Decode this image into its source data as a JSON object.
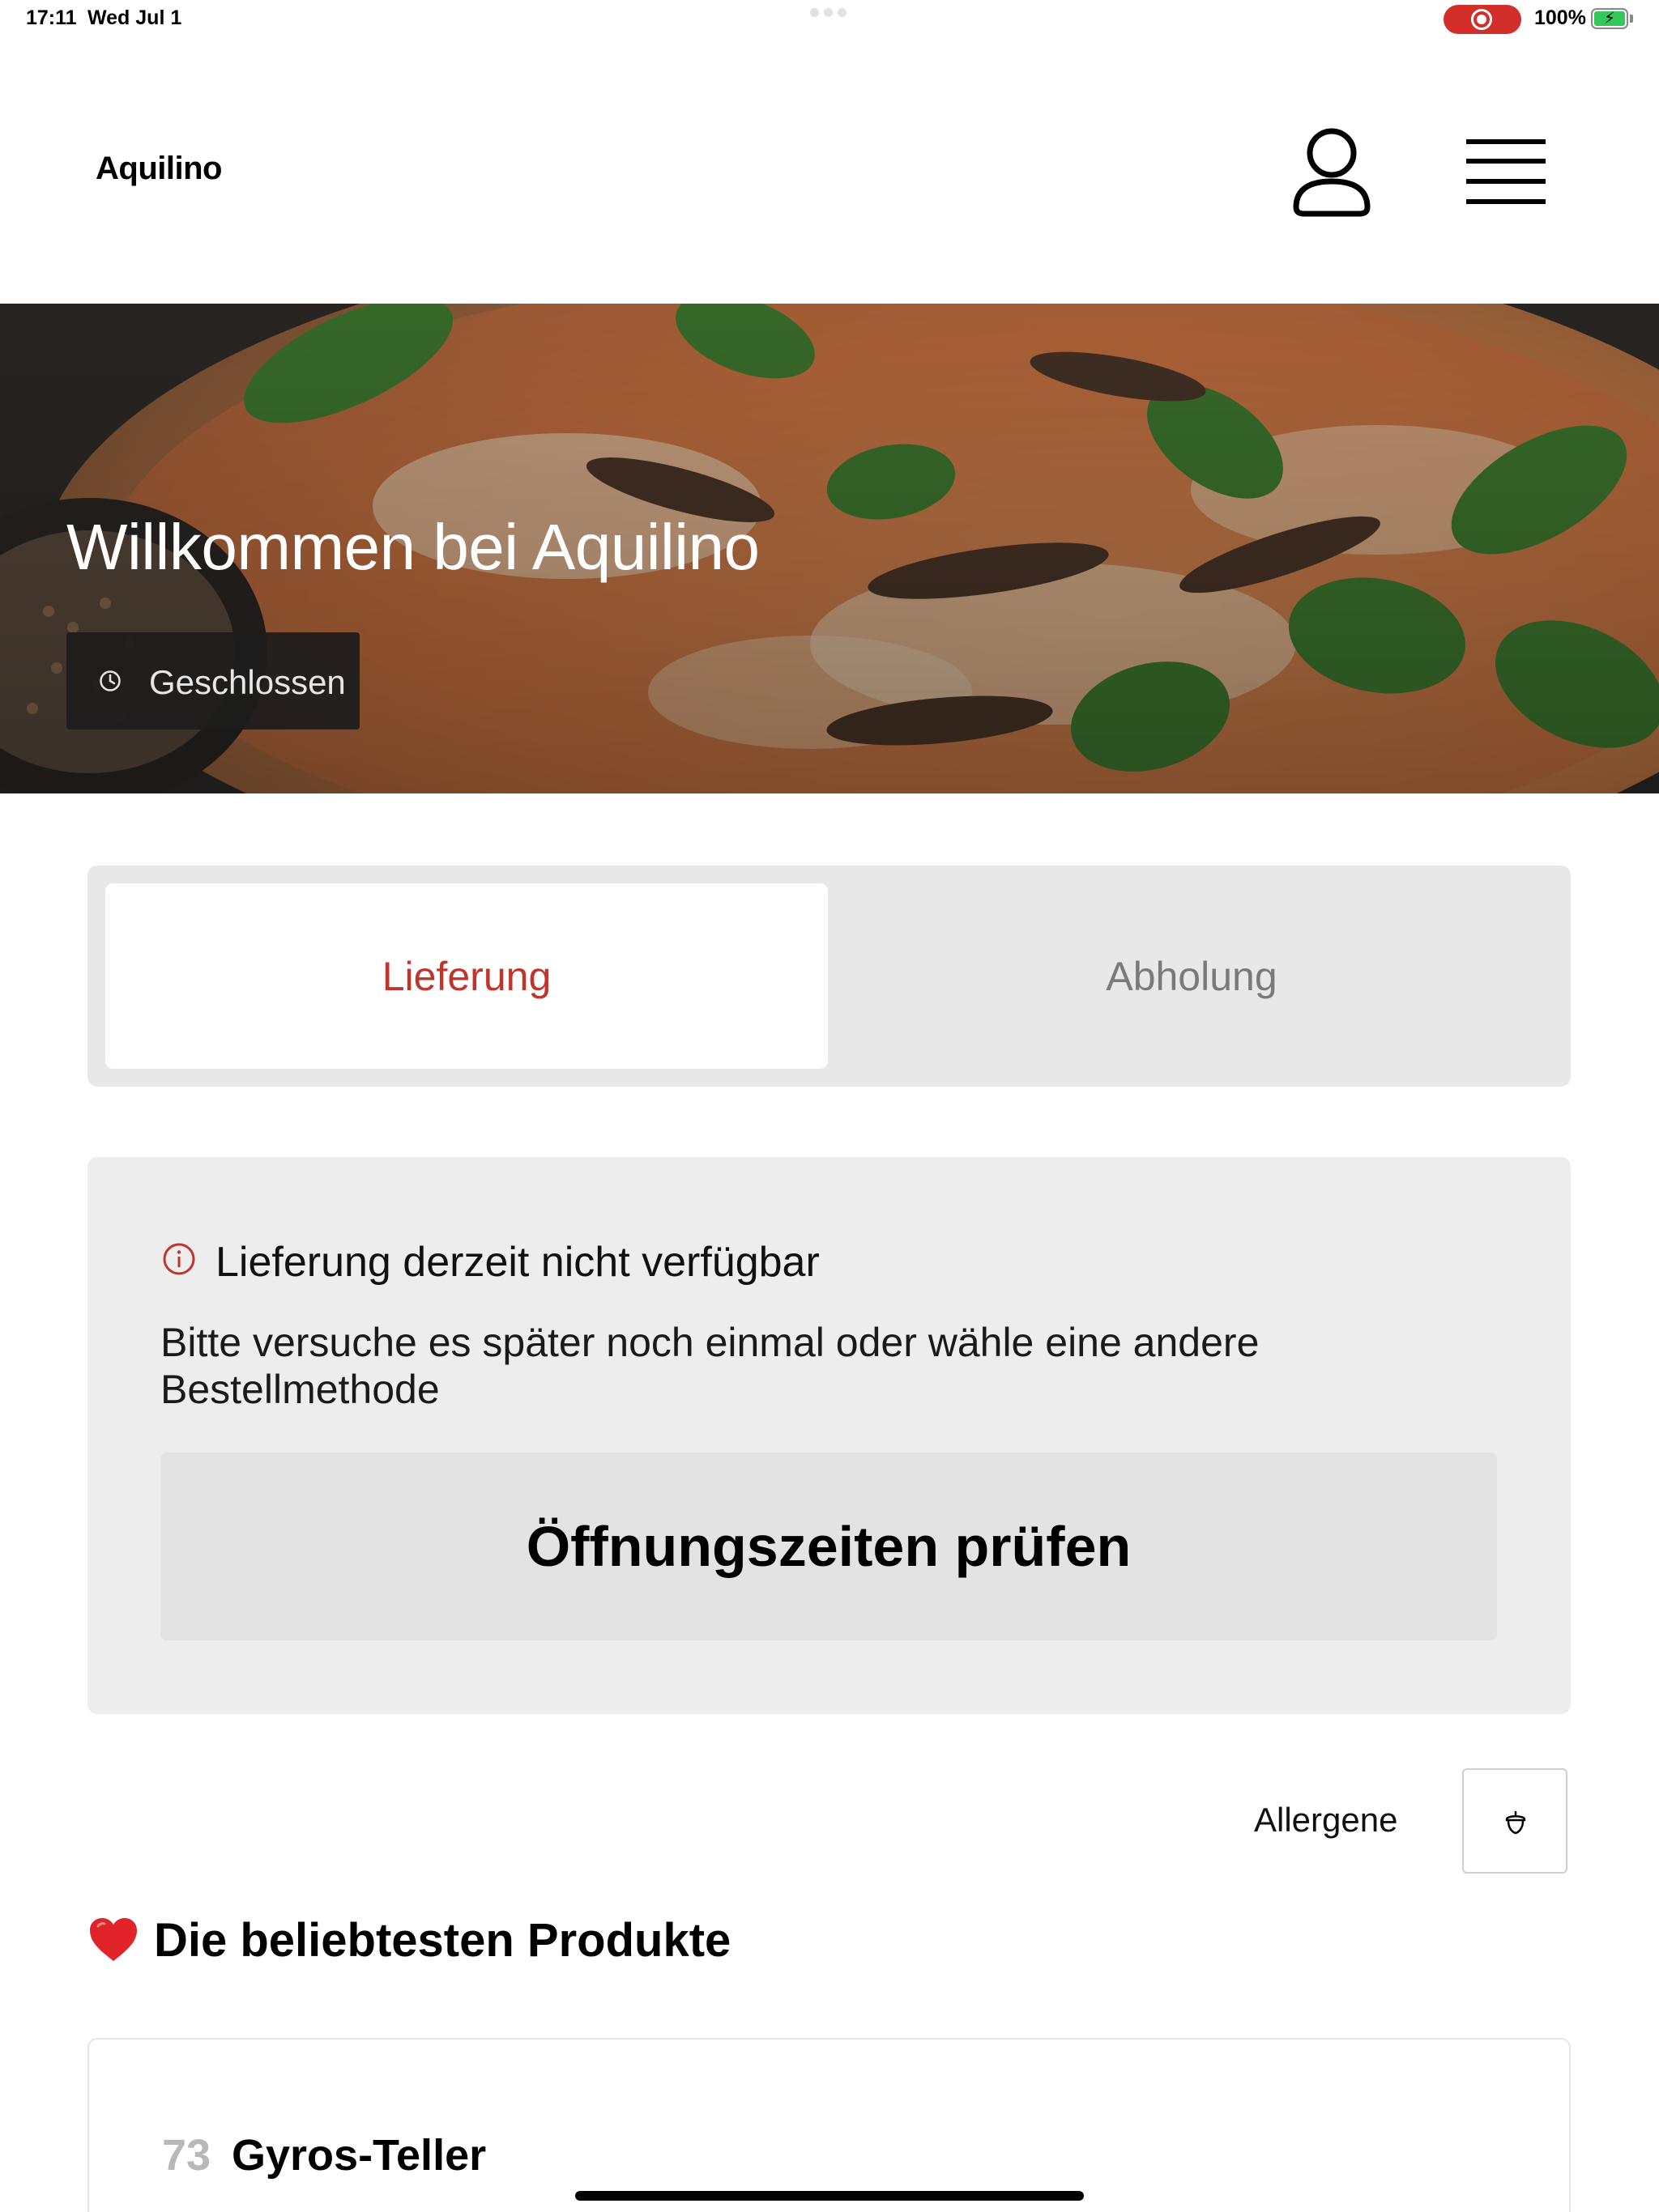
{
  "status_bar": {
    "time": "17:11",
    "date": "Wed Jul 1",
    "battery": "100%"
  },
  "header": {
    "brand": "Aquilino",
    "profile_icon": "user-icon",
    "menu_icon": "hamburger-menu-icon"
  },
  "hero": {
    "title": "Willkommen bei Aquilino",
    "status": "Geschlossen",
    "status_icon": "clock-icon"
  },
  "order_method": {
    "tabs": [
      {
        "label": "Lieferung",
        "active": true
      },
      {
        "label": "Abholung",
        "active": false
      }
    ]
  },
  "notice": {
    "icon": "info-icon",
    "title": "Lieferung derzeit nicht verfügbar",
    "body": "Bitte versuche es später noch einmal oder wähle eine andere Bestellmethode",
    "button": "Öffnungszeiten prüfen"
  },
  "allergens": {
    "label": "Allergene",
    "icon": "acorn-icon"
  },
  "popular": {
    "icon": "heart-icon",
    "title": "Die beliebtesten Produkte",
    "products": [
      {
        "number": "73",
        "name": "Gyros-Teller"
      }
    ]
  },
  "colors": {
    "accent": "#c0352b",
    "recording": "#d32f2a",
    "battery": "#34c759"
  }
}
